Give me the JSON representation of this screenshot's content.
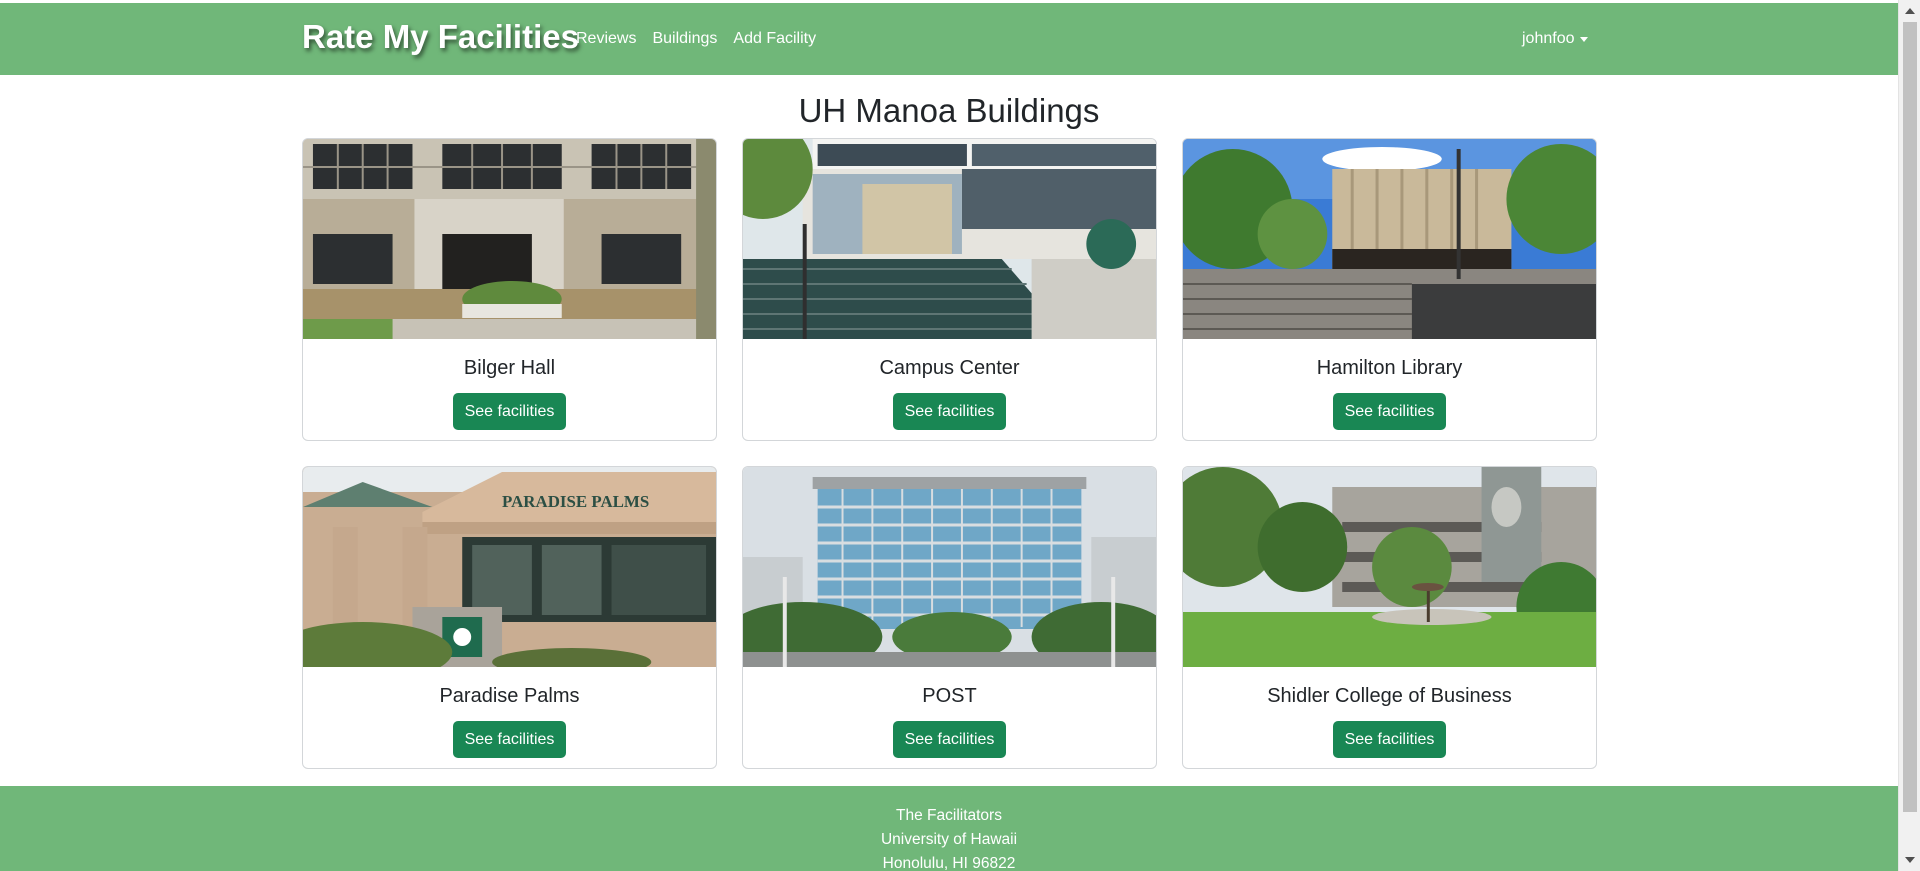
{
  "navbar": {
    "brand": "Rate My Facilities",
    "links": [
      "Reviews",
      "Buildings",
      "Add Facility"
    ],
    "user": "johnfoo"
  },
  "page_title": "UH Manoa Buildings",
  "buildings": [
    {
      "name": "Bilger Hall",
      "button": "See facilities"
    },
    {
      "name": "Campus Center",
      "button": "See facilities"
    },
    {
      "name": "Hamilton Library",
      "button": "See facilities"
    },
    {
      "name": "Paradise Palms",
      "button": "See facilities"
    },
    {
      "name": "POST",
      "button": "See facilities"
    },
    {
      "name": "Shidler College of Business",
      "button": "See facilities"
    }
  ],
  "footer": {
    "line1": "The Facilitators",
    "line2": "University of Hawaii",
    "line3": "Honolulu, HI 96822"
  },
  "colors": {
    "navbar": "#70b779",
    "button": "#198754"
  }
}
